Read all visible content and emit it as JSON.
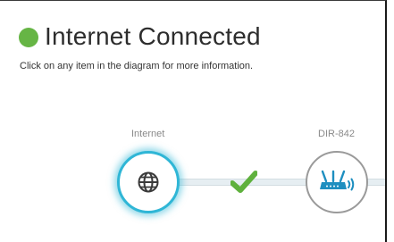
{
  "header": {
    "title": "Internet Connected",
    "subtitle": "Click on any item in the diagram for more information.",
    "status_color": "#66b545"
  },
  "diagram": {
    "nodes": [
      {
        "label": "Internet",
        "icon": "globe-icon",
        "state": "active"
      },
      {
        "label": "DIR-842",
        "icon": "router-icon",
        "state": "inactive"
      }
    ],
    "connection_status_icon": "checkmark-icon",
    "accent_color": "#2fb6d6"
  }
}
